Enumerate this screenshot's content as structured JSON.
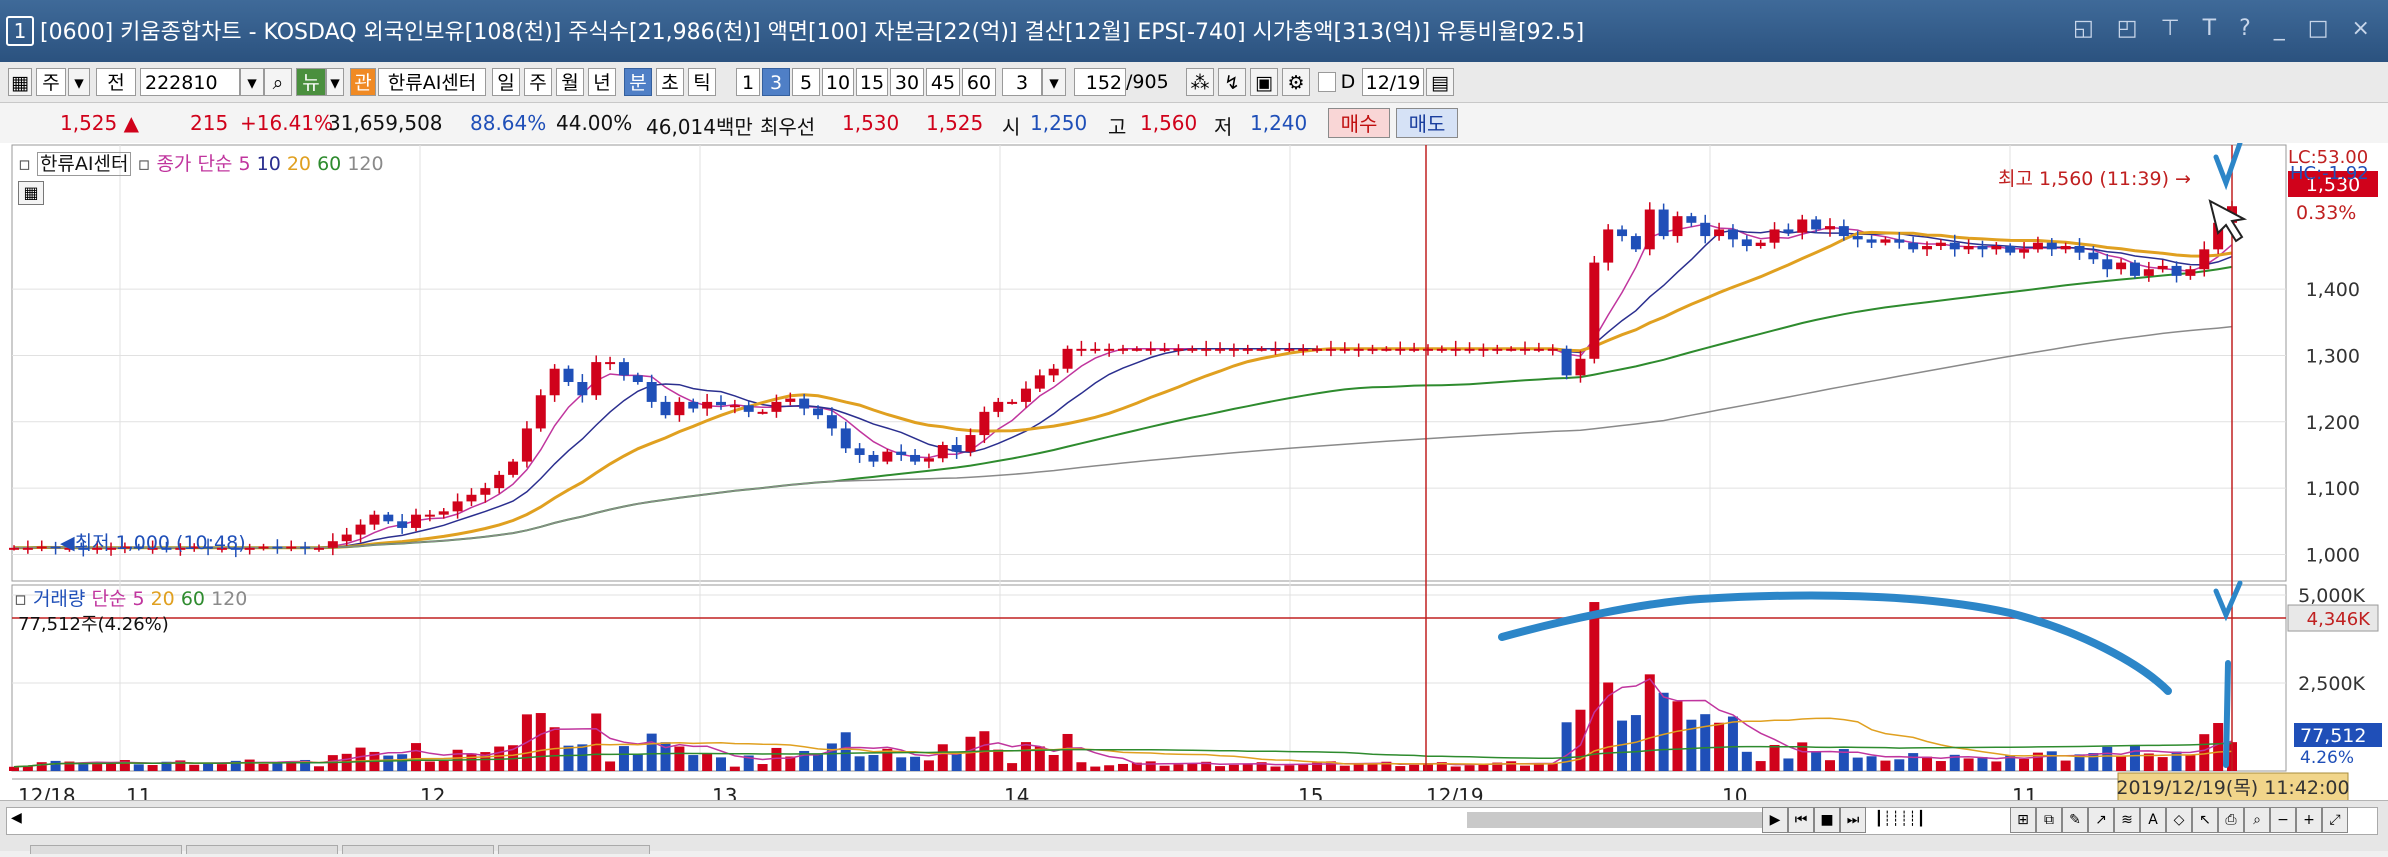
{
  "window": {
    "number": "1",
    "title": "[0600] 키움종합차트 - KOSDAQ 외국인보유[108(천)] 주식수[21,986(천)] 액면[100] 자본금[22(억)] 결산[12월] EPS[-740] 시가총액[313(억)] 유통비율[92.5]",
    "controls": "◱ ◰ ⊤ T ? _ □ ×"
  },
  "toolbar": {
    "period_label": "주",
    "prev_label": "전",
    "code": "222810",
    "news_label": "뉴",
    "interest_label": "관",
    "stock_name": "한류AI센터",
    "buttons": [
      "일",
      "주",
      "월",
      "년",
      "분",
      "초",
      "틱"
    ],
    "intervals": [
      "1",
      "3",
      "5",
      "10",
      "15",
      "30",
      "45",
      "60"
    ],
    "interval_value": "3",
    "count": "152",
    "total": "/905",
    "date_check_label": "D",
    "date_value": "12/19"
  },
  "quote": {
    "price": "1,525 ▲",
    "change": "215",
    "change_pct": "+16.41%",
    "volume": "31,659,508",
    "rate1": "88.64%",
    "rate2": "44.00%",
    "amount": "46,014백만",
    "best_label": "최우선",
    "best_ask": "1,530",
    "best_bid": "1,525",
    "open_label": "시",
    "open": "1,250",
    "high_label": "고",
    "high": "1,560",
    "low_label": "저",
    "low": "1,240",
    "buy_label": "매수",
    "sell_label": "매도"
  },
  "colors": {
    "up": "#d0021b",
    "down": "#1f4fb8",
    "ma5": "#c0359e",
    "ma10": "#2b2f8f",
    "ma20": "#e0a020",
    "ma60": "#2e8b2e",
    "ma120": "#8a8a8a",
    "annotation": "#2c86c8"
  },
  "chart_data": [
    {
      "type": "candlestick",
      "legend": {
        "name": "한류AI센터",
        "ma_label": "종가 단순",
        "periods": [
          "5",
          "10",
          "20",
          "60",
          "120"
        ]
      },
      "x_ticks": [
        "12/18",
        "11",
        "12",
        "13",
        "14",
        "15",
        "12/19",
        "10",
        "11"
      ],
      "y_ticks": [
        "1,000",
        "1,100",
        "1,200",
        "1,300",
        "1,400"
      ],
      "ylim": [
        960,
        1560
      ],
      "price_boxes": {
        "lc": "LC:53.00",
        "current": "1,530",
        "hc": "HC:-1.92",
        "pct": "0.33%"
      },
      "annotations": {
        "high": "최고 1,560 (11:39) →",
        "low": "◀최저 1,000 (10:48)"
      },
      "close": [
        1010,
        1010,
        1012,
        1010,
        1010,
        1008,
        1010,
        1010,
        1012,
        1010,
        1010,
        1008,
        1010,
        1012,
        1010,
        1010,
        1008,
        1010,
        1012,
        1010,
        1012,
        1010,
        1010,
        1020,
        1030,
        1045,
        1060,
        1050,
        1040,
        1060,
        1060,
        1065,
        1080,
        1090,
        1100,
        1120,
        1140,
        1190,
        1240,
        1280,
        1260,
        1240,
        1290,
        1290,
        1270,
        1260,
        1230,
        1210,
        1230,
        1220,
        1230,
        1225,
        1225,
        1215,
        1215,
        1230,
        1235,
        1220,
        1210,
        1190,
        1160,
        1150,
        1140,
        1155,
        1150,
        1140,
        1145,
        1165,
        1155,
        1180,
        1215,
        1230,
        1230,
        1250,
        1270,
        1280,
        1310,
        1310,
        1310,
        1310,
        1310,
        1310,
        1310,
        1310,
        1310,
        1310,
        1310,
        1310,
        1310,
        1310,
        1310,
        1310,
        1310,
        1310,
        1310,
        1310,
        1310,
        1310,
        1310,
        1310,
        1310,
        1310,
        1310,
        1310,
        1310,
        1310,
        1310,
        1310,
        1310,
        1310,
        1310,
        1310,
        1270,
        1295,
        1440,
        1490,
        1480,
        1460,
        1520,
        1480,
        1510,
        1500,
        1480,
        1490,
        1475,
        1465,
        1470,
        1490,
        1485,
        1505,
        1490,
        1495,
        1480,
        1475,
        1470,
        1475,
        1470,
        1460,
        1465,
        1470,
        1460,
        1465,
        1460,
        1465,
        1455,
        1460,
        1470,
        1460,
        1465,
        1455,
        1445,
        1430,
        1440,
        1420,
        1430,
        1435,
        1420,
        1430,
        1460,
        1500,
        1525
      ],
      "volume_ylim": [
        0,
        5000
      ],
      "volume_ticks": [
        "5,000K",
        "2,500K"
      ],
      "volume_legend": {
        "name": "거래량",
        "ma_label": "단순",
        "periods": [
          "5",
          "20",
          "60",
          "120"
        ]
      },
      "volume_label": "77,512주(4.26%)",
      "volume_boxes": {
        "line_value": "4,346K",
        "current": "77,512",
        "pct": "4.26%"
      },
      "time_label": "2019/12/19(목) 11:42:00"
    }
  ]
}
